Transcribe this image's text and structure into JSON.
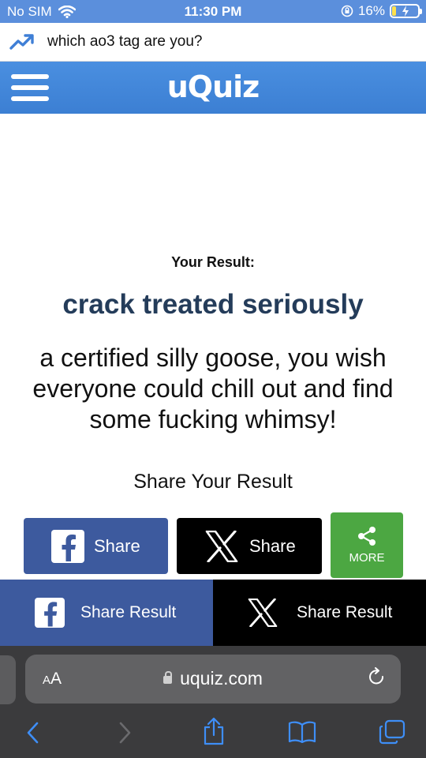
{
  "status_bar": {
    "carrier": "No SIM",
    "time": "11:30 PM",
    "battery_percent": "16%",
    "battery_level": 0.16
  },
  "banner": {
    "icon": "trending-up-icon",
    "title": "which ao3 tag are you?"
  },
  "header": {
    "logo": "uQuiz",
    "menu_icon": "hamburger-menu-icon"
  },
  "result": {
    "label": "Your Result:",
    "title": "crack treated seriously",
    "description": "a certified silly goose, you wish everyone could chill out and find some fucking whimsy!"
  },
  "share": {
    "heading": "Share Your Result",
    "facebook_label": "Share",
    "x_label": "Share",
    "more_label": "MORE"
  },
  "sticky_share": {
    "facebook_label": "Share Result",
    "x_label": "Share Result"
  },
  "browser": {
    "text_size": "AA",
    "url": "uquiz.com"
  },
  "colors": {
    "header_blue": "#3c7fd3",
    "facebook_blue": "#3d5a9e",
    "more_green": "#4ca742",
    "result_title": "#243c5a"
  }
}
